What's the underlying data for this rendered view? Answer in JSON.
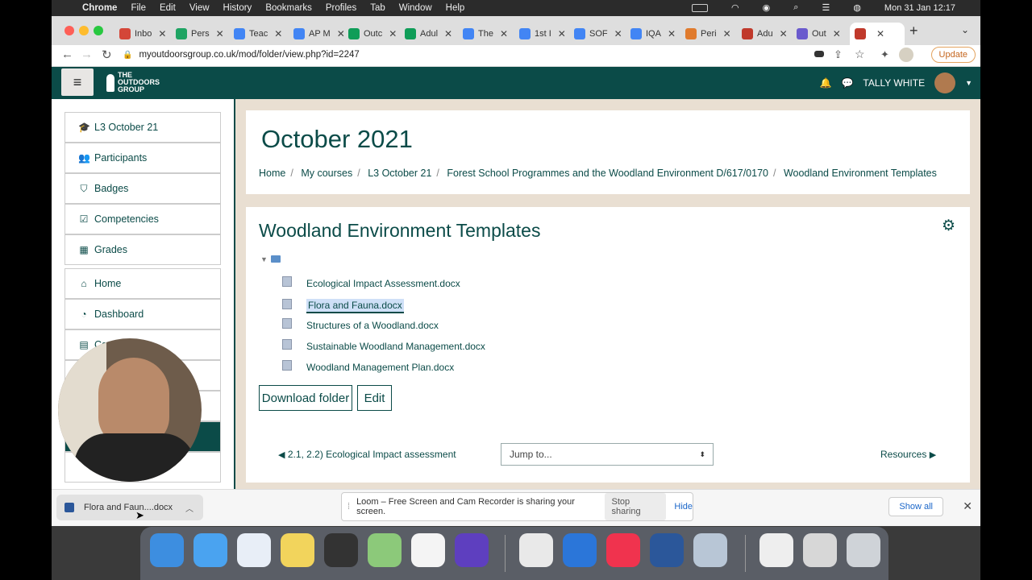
{
  "macos": {
    "apple_icon": "apple-icon",
    "app_name": "Chrome",
    "menus": [
      "File",
      "Edit",
      "View",
      "History",
      "Bookmarks",
      "Profiles",
      "Tab",
      "Window",
      "Help"
    ],
    "clock": "Mon 31 Jan  12:17"
  },
  "browser": {
    "tabs": [
      {
        "label": "Inbo",
        "icon": "gmail-icon",
        "color": "#d44638"
      },
      {
        "label": "Pers",
        "icon": "drive-icon",
        "color": "#1fa463"
      },
      {
        "label": "Teac",
        "icon": "docs-icon",
        "color": "#4285f4"
      },
      {
        "label": "AP M",
        "icon": "docs-icon",
        "color": "#4285f4"
      },
      {
        "label": "Outc",
        "icon": "sheets-icon",
        "color": "#0f9d58"
      },
      {
        "label": "Adul",
        "icon": "sheets-icon",
        "color": "#0f9d58"
      },
      {
        "label": "The",
        "icon": "calendar-icon",
        "color": "#4285f4"
      },
      {
        "label": "1st I",
        "icon": "docs-icon",
        "color": "#4285f4"
      },
      {
        "label": "SOF",
        "icon": "docs-icon",
        "color": "#4285f4"
      },
      {
        "label": "IQA",
        "icon": "docs-icon",
        "color": "#4285f4"
      },
      {
        "label": "Peri",
        "icon": "site-icon",
        "color": "#e07b2d"
      },
      {
        "label": "Adu",
        "icon": "site-icon",
        "color": "#c0392b"
      },
      {
        "label": "Out",
        "icon": "gear-favicon-icon",
        "color": "#6a5acd"
      },
      {
        "label": "",
        "icon": "outdoors-favicon-icon",
        "color": "#c0392b"
      }
    ],
    "url": "myoutdoorsgroup.co.uk/mod/folder/view.php?id=2247",
    "update_label": "Update"
  },
  "site": {
    "logo_lines": [
      "THE",
      "OUTDOORS",
      "GROUP"
    ],
    "user_name": "TALLY WHITE"
  },
  "drawer": {
    "course_items": [
      {
        "label": "L3 October 21",
        "icon": "mortarboard-icon",
        "glyph": "🎓"
      },
      {
        "label": "Participants",
        "icon": "users-icon",
        "glyph": "👥"
      },
      {
        "label": "Badges",
        "icon": "shield-icon",
        "glyph": "⛉"
      },
      {
        "label": "Competencies",
        "icon": "check-square-icon",
        "glyph": "☑"
      },
      {
        "label": "Grades",
        "icon": "table-icon",
        "glyph": "▦"
      }
    ],
    "site_items": [
      {
        "label": "Home",
        "icon": "home-icon",
        "glyph": "⌂"
      },
      {
        "label": "Dashboard",
        "icon": "dashboard-icon",
        "glyph": "◔"
      },
      {
        "label": "Ca",
        "icon": "calendar-icon",
        "glyph": "▤"
      }
    ]
  },
  "header": {
    "title": "October 2021",
    "breadcrumb": [
      "Home",
      "My courses",
      "L3 October 21",
      "Forest School Programmes and the Woodland Environment D/617/0170",
      "Woodland Environment Templates"
    ]
  },
  "folder": {
    "title": "Woodland Environment Templates",
    "files": [
      "Ecological Impact Assessment.docx",
      "Flora and Fauna.docx",
      "Structures of a Woodland.docx",
      "Sustainable Woodland Management.docx",
      "Woodland Management Plan.docx"
    ],
    "selected_index": 1,
    "download_label": "Download folder",
    "edit_label": "Edit"
  },
  "activity_nav": {
    "prev": "2.1, 2.2) Ecological Impact assessment",
    "jump_placeholder": "Jump to...",
    "next": "Resources"
  },
  "downloads": {
    "file": "Flora and Faun....docx",
    "show_all": "Show all"
  },
  "loom": {
    "message": "Loom – Free Screen and Cam Recorder is sharing your screen.",
    "stop": "Stop sharing",
    "hide": "Hide"
  },
  "colors": {
    "brand": "#0b4b48",
    "page_bg": "#e9dfd2"
  }
}
